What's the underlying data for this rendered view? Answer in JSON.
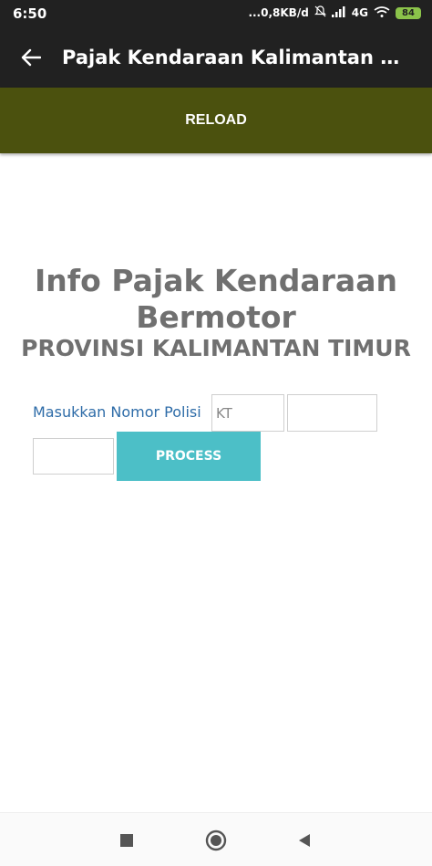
{
  "status_bar": {
    "time": "6:50",
    "speed": "...0,8KB/d",
    "network": "4G",
    "battery": "84"
  },
  "app_bar": {
    "title": "Pajak Kendaraan Kalimantan Ti..."
  },
  "reload_button": {
    "label": "RELOAD"
  },
  "page": {
    "title_line1": "Info Pajak Kendaraan",
    "title_line2": "Bermotor",
    "subtitle": "PROVINSI KALIMANTAN TIMUR"
  },
  "form": {
    "label": "Masukkan Nomor Polisi",
    "prefix_value": "KT",
    "number_value": "",
    "suffix_value": "",
    "process_label": "PROCESS"
  },
  "colors": {
    "reload_bg": "#4b510e",
    "process_bg": "#4cbfc7",
    "label_color": "#2e6ca8",
    "title_color": "#707070"
  }
}
